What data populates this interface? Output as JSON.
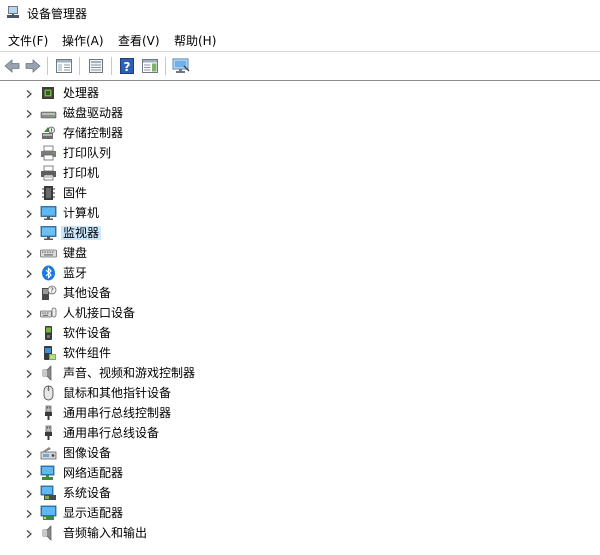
{
  "window": {
    "title": "设备管理器"
  },
  "menu": [
    "文件(F)",
    "操作(A)",
    "查看(V)",
    "帮助(H)"
  ],
  "toolbar": {
    "buttons": [
      "back-icon",
      "forward-icon",
      "properties-pane-icon",
      "console-icon",
      "help-icon",
      "action-pane-icon",
      "monitor-scan-icon"
    ]
  },
  "tree": {
    "selected": "监视器",
    "items": [
      {
        "label": "处理器",
        "icon": "processor-icon"
      },
      {
        "label": "磁盘驱动器",
        "icon": "disk-drive-icon"
      },
      {
        "label": "存储控制器",
        "icon": "storage-controller-icon"
      },
      {
        "label": "打印队列",
        "icon": "print-queue-icon"
      },
      {
        "label": "打印机",
        "icon": "printer-icon"
      },
      {
        "label": "固件",
        "icon": "firmware-icon"
      },
      {
        "label": "计算机",
        "icon": "computer-icon"
      },
      {
        "label": "监视器",
        "icon": "monitor-icon"
      },
      {
        "label": "键盘",
        "icon": "keyboard-icon"
      },
      {
        "label": "蓝牙",
        "icon": "bluetooth-icon"
      },
      {
        "label": "其他设备",
        "icon": "other-devices-icon"
      },
      {
        "label": "人机接口设备",
        "icon": "hid-icon"
      },
      {
        "label": "软件设备",
        "icon": "software-device-icon"
      },
      {
        "label": "软件组件",
        "icon": "software-component-icon"
      },
      {
        "label": "声音、视频和游戏控制器",
        "icon": "speaker-icon"
      },
      {
        "label": "鼠标和其他指针设备",
        "icon": "mouse-icon"
      },
      {
        "label": "通用串行总线控制器",
        "icon": "usb-icon"
      },
      {
        "label": "通用串行总线设备",
        "icon": "usb-device-icon"
      },
      {
        "label": "图像设备",
        "icon": "imaging-device-icon"
      },
      {
        "label": "网络适配器",
        "icon": "network-adapter-icon"
      },
      {
        "label": "系统设备",
        "icon": "system-device-icon"
      },
      {
        "label": "显示适配器",
        "icon": "display-adapter-icon"
      },
      {
        "label": "音频输入和输出",
        "icon": "audio-io-icon"
      }
    ]
  },
  "colors": {
    "selection": "#cce8ff",
    "accent": "#1e6fd9"
  }
}
